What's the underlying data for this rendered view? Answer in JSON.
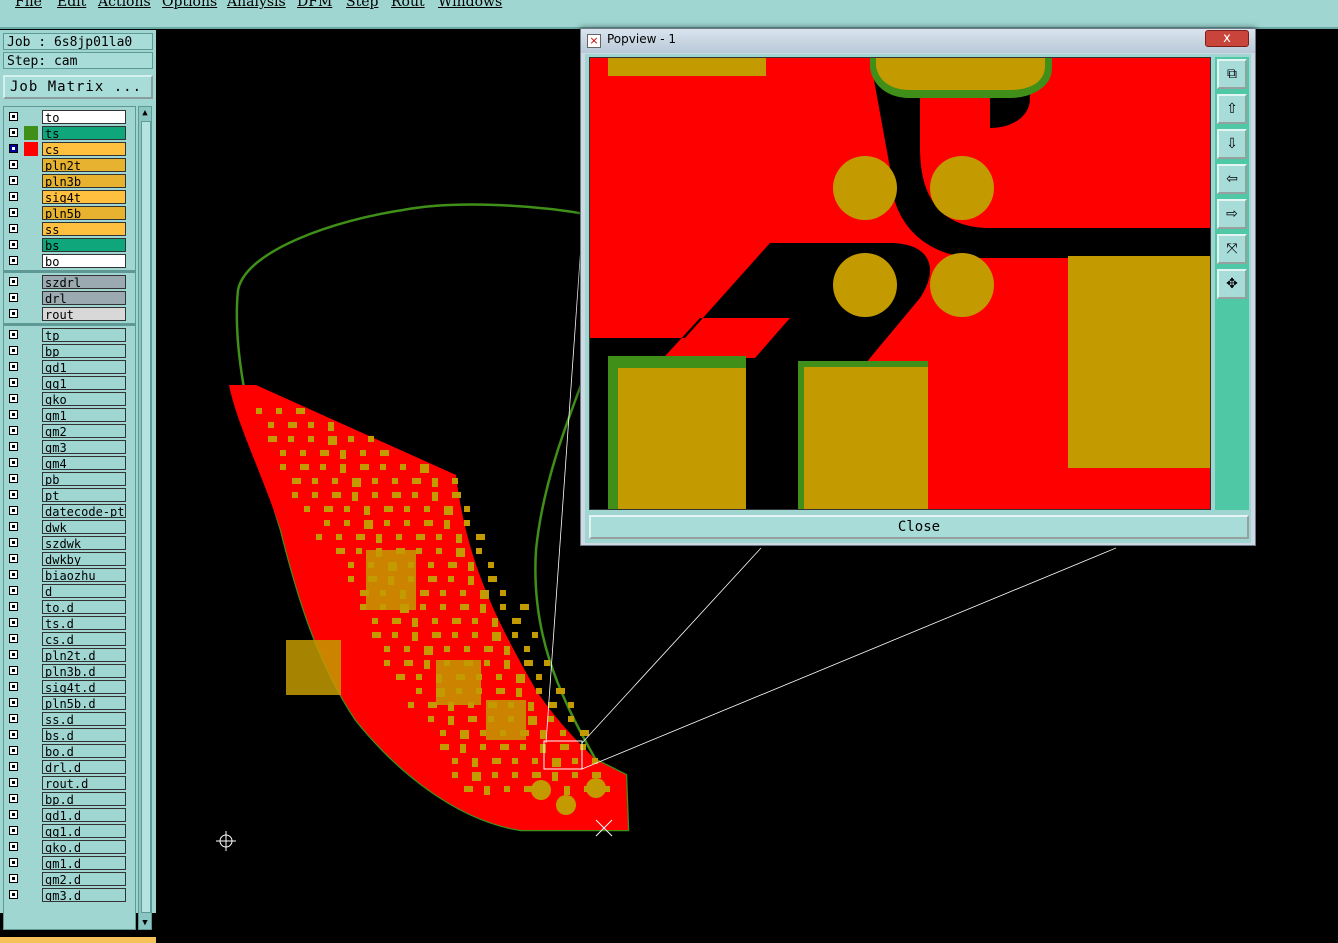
{
  "menu": {
    "items": [
      "File",
      "Edit",
      "Actions",
      "Options",
      "Analysis",
      "DFM",
      "Step",
      "Rout",
      "Windows"
    ]
  },
  "job": {
    "job_label": "Job : 6s8jp01la0",
    "step_label": "Step: cam",
    "matrix_button": "Job Matrix ..."
  },
  "layers": [
    {
      "name": "to",
      "color": "#ffffff",
      "sel": ""
    },
    {
      "name": "ts",
      "color": "#0ea67a",
      "sel": "#3f8f18"
    },
    {
      "name": "cs",
      "color": "#ffc040",
      "sel": "#ff0000",
      "active": true
    },
    {
      "name": "pln2t",
      "color": "#e6b230",
      "sel": ""
    },
    {
      "name": "pln3b",
      "color": "#e6b230",
      "sel": ""
    },
    {
      "name": "sig4t",
      "color": "#ffc040",
      "sel": ""
    },
    {
      "name": "pln5b",
      "color": "#e6b230",
      "sel": ""
    },
    {
      "name": "ss",
      "color": "#ffc040",
      "sel": ""
    },
    {
      "name": "bs",
      "color": "#0ea67a",
      "sel": ""
    },
    {
      "name": "bo",
      "color": "#ffffff",
      "sel": ""
    },
    {
      "name": "szdrl",
      "color": "#9aaab0",
      "sel": "",
      "group": 2
    },
    {
      "name": "drl",
      "color": "#9aaab0",
      "sel": "",
      "group": 2
    },
    {
      "name": "rout",
      "color": "#d8d8d8",
      "sel": "",
      "group": 2
    },
    {
      "name": "tp",
      "color": "#9fd6d2",
      "sel": "",
      "group": 3
    },
    {
      "name": "bp",
      "color": "#9fd6d2",
      "sel": "",
      "group": 3
    },
    {
      "name": "gd1",
      "color": "#9fd6d2",
      "sel": "",
      "group": 3
    },
    {
      "name": "gg1",
      "color": "#9fd6d2",
      "sel": "",
      "group": 3
    },
    {
      "name": "gko",
      "color": "#9fd6d2",
      "sel": "",
      "group": 3
    },
    {
      "name": "gm1",
      "color": "#9fd6d2",
      "sel": "",
      "group": 3
    },
    {
      "name": "gm2",
      "color": "#9fd6d2",
      "sel": "",
      "group": 3
    },
    {
      "name": "gm3",
      "color": "#9fd6d2",
      "sel": "",
      "group": 3
    },
    {
      "name": "gm4",
      "color": "#9fd6d2",
      "sel": "",
      "group": 3
    },
    {
      "name": "pb",
      "color": "#9fd6d2",
      "sel": "",
      "group": 3
    },
    {
      "name": "pt",
      "color": "#9fd6d2",
      "sel": "",
      "group": 3
    },
    {
      "name": "datecode-pt",
      "color": "#9fd6d2",
      "sel": "",
      "group": 3
    },
    {
      "name": "dwk",
      "color": "#9fd6d2",
      "sel": "",
      "group": 3
    },
    {
      "name": "szdwk",
      "color": "#9fd6d2",
      "sel": "",
      "group": 3
    },
    {
      "name": "dwkby",
      "color": "#9fd6d2",
      "sel": "",
      "group": 3
    },
    {
      "name": "biaozhu",
      "color": "#9fd6d2",
      "sel": "",
      "group": 3
    },
    {
      "name": "d",
      "color": "#9fd6d2",
      "sel": "",
      "group": 3
    },
    {
      "name": "to.d",
      "color": "#9fd6d2",
      "sel": "",
      "group": 3
    },
    {
      "name": "ts.d",
      "color": "#9fd6d2",
      "sel": "",
      "group": 3
    },
    {
      "name": "cs.d",
      "color": "#9fd6d2",
      "sel": "",
      "group": 3
    },
    {
      "name": "pln2t.d",
      "color": "#9fd6d2",
      "sel": "",
      "group": 3
    },
    {
      "name": "pln3b.d",
      "color": "#9fd6d2",
      "sel": "",
      "group": 3
    },
    {
      "name": "sig4t.d",
      "color": "#9fd6d2",
      "sel": "",
      "group": 3
    },
    {
      "name": "pln5b.d",
      "color": "#9fd6d2",
      "sel": "",
      "group": 3
    },
    {
      "name": "ss.d",
      "color": "#9fd6d2",
      "sel": "",
      "group": 3
    },
    {
      "name": "bs.d",
      "color": "#9fd6d2",
      "sel": "",
      "group": 3
    },
    {
      "name": "bo.d",
      "color": "#9fd6d2",
      "sel": "",
      "group": 3
    },
    {
      "name": "drl.d",
      "color": "#9fd6d2",
      "sel": "",
      "group": 3
    },
    {
      "name": "rout.d",
      "color": "#9fd6d2",
      "sel": "",
      "group": 3
    },
    {
      "name": "bp.d",
      "color": "#9fd6d2",
      "sel": "",
      "group": 3
    },
    {
      "name": "gd1.d",
      "color": "#9fd6d2",
      "sel": "",
      "group": 3
    },
    {
      "name": "gg1.d",
      "color": "#9fd6d2",
      "sel": "",
      "group": 3
    },
    {
      "name": "gko.d",
      "color": "#9fd6d2",
      "sel": "",
      "group": 3
    },
    {
      "name": "gm1.d",
      "color": "#9fd6d2",
      "sel": "",
      "group": 3
    },
    {
      "name": "gm2.d",
      "color": "#9fd6d2",
      "sel": "",
      "group": 3
    },
    {
      "name": "gm3.d",
      "color": "#9fd6d2",
      "sel": "",
      "group": 3
    }
  ],
  "popview": {
    "title": "Popview - 1",
    "close_label": "Close",
    "close_x": "x",
    "tools": [
      "zoom-home-icon",
      "zoom-in-icon",
      "zoom-out-icon",
      "pan-left-icon",
      "pan-right-icon",
      "fit-icon",
      "center-icon"
    ]
  },
  "colors": {
    "copper": "#ff0000",
    "pad": "#c39a00",
    "outline": "#3f8f18",
    "panel": "#9fd6d2"
  }
}
